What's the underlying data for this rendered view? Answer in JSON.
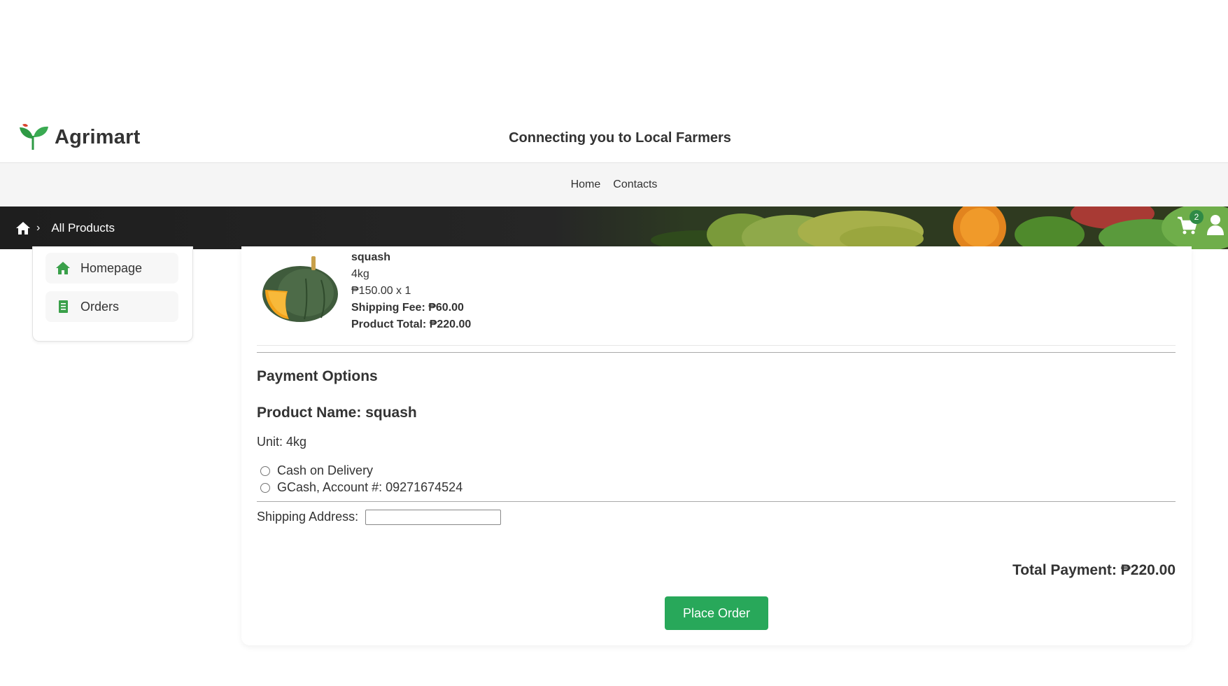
{
  "brand": {
    "name": "Agrimart",
    "logo_icon": "sprout-logo-icon"
  },
  "header": {
    "tagline": "Connecting you to Local Farmers"
  },
  "nav": {
    "home": "Home",
    "contacts": "Contacts"
  },
  "breadcrumb": {
    "home_icon": "home-icon",
    "separator": "›",
    "current": "All Products"
  },
  "cart": {
    "count": "2",
    "icon": "cart-icon"
  },
  "account": {
    "icon": "user-icon"
  },
  "sidebar": {
    "items": [
      {
        "label": "Homepage",
        "icon": "home-icon"
      },
      {
        "label": "Orders",
        "icon": "receipt-icon"
      }
    ]
  },
  "product": {
    "name": "squash",
    "unit": "4kg",
    "price_qty": "₱150.00 x 1",
    "shipping": "Shipping Fee: ₱60.00",
    "total": "Product Total: ₱220.00"
  },
  "payment": {
    "heading": "Payment Options",
    "product_name": "Product Name: squash",
    "unit": "Unit: 4kg",
    "options": [
      {
        "label": "Cash on Delivery"
      },
      {
        "label": "GCash, Account #: 09271674524"
      }
    ],
    "address_label": "Shipping Address:",
    "address_value": ""
  },
  "summary": {
    "total": "Total Payment: ₱220.00",
    "place_order": "Place Order"
  },
  "colors": {
    "accent_green": "#28a85a",
    "banner_dark": "#1e1e1e",
    "badge_green": "#2f8a46"
  }
}
